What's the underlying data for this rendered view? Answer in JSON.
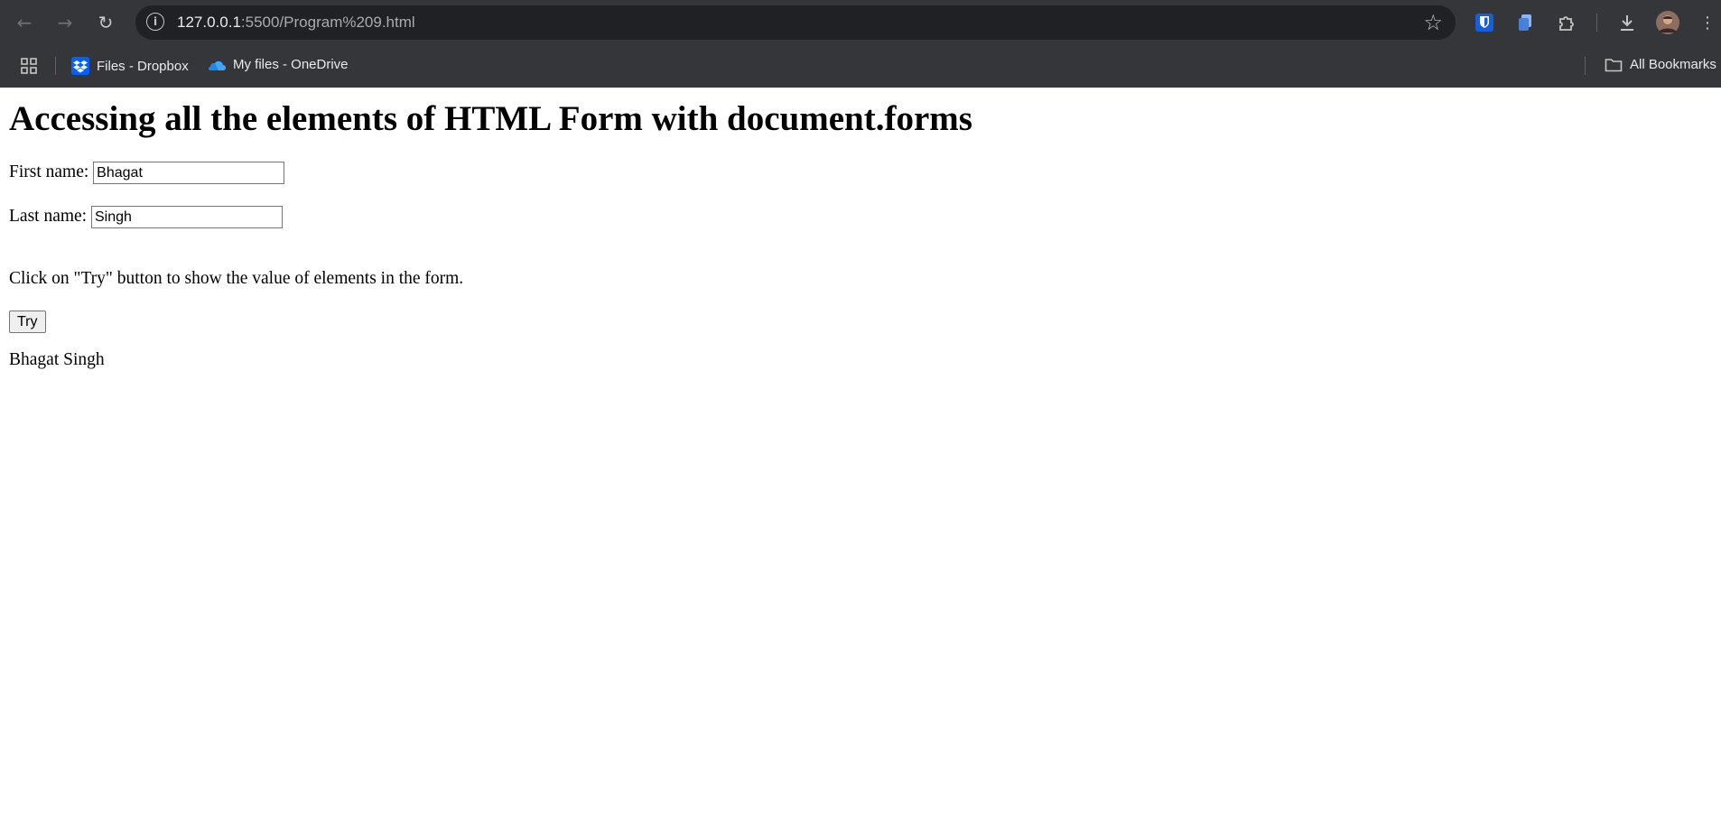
{
  "browser": {
    "url_host": "127.0.0.1",
    "url_path": ":5500/Program%209.html",
    "info_icon": "info-icon",
    "bookmarks": [
      {
        "label": "Files - Dropbox",
        "icon": "dropbox-icon"
      },
      {
        "label": "My files - OneDrive",
        "icon": "onedrive-icon"
      }
    ],
    "all_bookmarks_label": "All Bookmarks"
  },
  "page": {
    "heading": "Accessing all the elements of HTML Form with document.forms",
    "first_name_label": "First name:",
    "first_name_value": "Bhagat",
    "last_name_label": "Last name:",
    "last_name_value": "Singh",
    "instruction": "Click on \"Try\" button to show the value of elements in the form.",
    "try_button_label": "Try",
    "output": "Bhagat Singh"
  },
  "colors": {
    "chrome_bg": "#35363a",
    "omnibox_bg": "#202124",
    "page_bg": "#ffffff"
  }
}
